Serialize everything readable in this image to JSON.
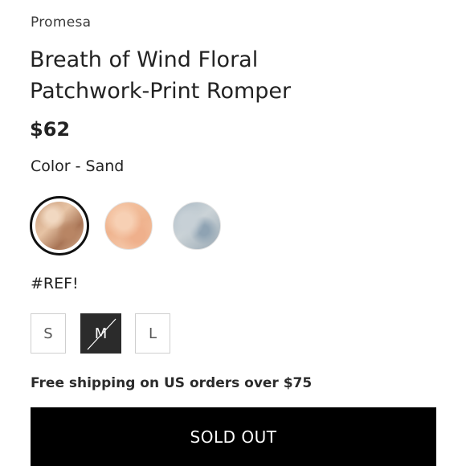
{
  "product": {
    "brand": "Promesa",
    "title": "Breath of Wind Floral Patchwork-Print Romper",
    "price": "$62",
    "color_label": "Color - Sand"
  },
  "swatches": [
    {
      "name": "Sand",
      "selected": true
    },
    {
      "name": "Peach",
      "selected": false
    },
    {
      "name": "Blue",
      "selected": false
    }
  ],
  "size": {
    "label": "#REF!",
    "options": [
      {
        "label": "S",
        "available": true,
        "selected": false
      },
      {
        "label": "M",
        "available": false,
        "selected": true
      },
      {
        "label": "L",
        "available": true,
        "selected": false
      }
    ]
  },
  "shipping_text": "Free shipping on US orders over $75",
  "cta": {
    "label": "SOLD OUT"
  },
  "colors": {
    "cta_background": "#000000",
    "selected_size_background": "#2b2b2b"
  }
}
